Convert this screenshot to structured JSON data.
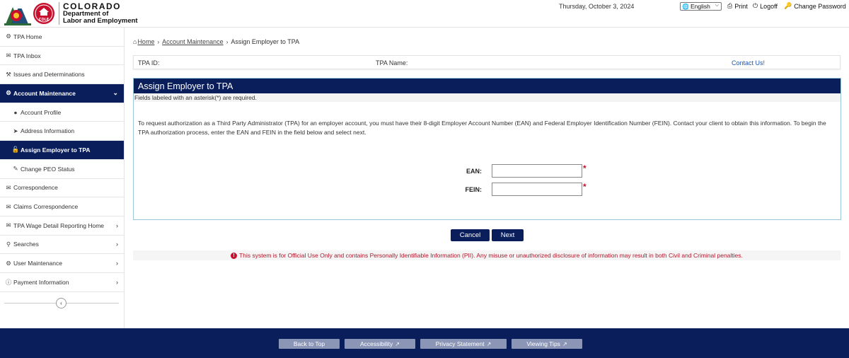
{
  "header": {
    "logo": {
      "state": "COLORADO",
      "line2": "Department of",
      "line3": "Labor and Employment",
      "seal_text": "CDLE"
    },
    "date": "Thursday, October 3, 2024",
    "language": {
      "selected": "English",
      "icon": "globe-icon"
    },
    "links": [
      {
        "label": "Print",
        "icon": "print-icon"
      },
      {
        "label": "Logoff",
        "icon": "power-icon"
      },
      {
        "label": "Change Password",
        "icon": "key-icon"
      }
    ]
  },
  "sidebar": {
    "items": [
      {
        "label": "TPA Home",
        "icon": "gauge-icon"
      },
      {
        "label": "TPA Inbox",
        "icon": "envelope-icon"
      },
      {
        "label": "Issues and Determinations",
        "icon": "gavel-icon"
      },
      {
        "label": "Account Maintenance",
        "icon": "cogs-icon"
      },
      {
        "label": "Account Profile",
        "icon": "user-icon"
      },
      {
        "label": "Address Information",
        "icon": "location-arrow-icon"
      },
      {
        "label": "Assign Employer to TPA",
        "icon": "lock-icon"
      },
      {
        "label": "Change PEO Status",
        "icon": "edit-icon"
      },
      {
        "label": "Correspondence",
        "icon": "envelope-icon"
      },
      {
        "label": "Claims Correspondence",
        "icon": "envelope-icon"
      },
      {
        "label": "TPA Wage Detail Reporting Home",
        "icon": "envelope-icon"
      },
      {
        "label": "Searches",
        "icon": "search-icon"
      },
      {
        "label": "User Maintenance",
        "icon": "cogs-icon"
      },
      {
        "label": "Payment Information",
        "icon": "info-circle-icon"
      }
    ]
  },
  "breadcrumb": {
    "home": "Home",
    "parent": "Account Maintenance",
    "current": "Assign Employer to TPA"
  },
  "tpa_bar": {
    "tpa_id_label": "TPA ID:",
    "tpa_name_label": "TPA Name:",
    "contact": "Contact Us!"
  },
  "panel": {
    "title": "Assign Employer to TPA",
    "required_note": "Fields labeled with an asterisk(*) are required.",
    "instructions": "To request authorization as a Third Party Administrator (TPA) for an employer account, you must have their 8-digit Employer Account Number (EAN) and Federal Employer Identification Number (FEIN). Contact your client to obtain this information. To begin the TPA authorization process, enter the EAN and FEIN in the field below and select next.",
    "fields": [
      {
        "label": "EAN:",
        "value": "",
        "required": "*"
      },
      {
        "label": "FEIN:",
        "value": "",
        "required": "*"
      }
    ]
  },
  "actions": {
    "cancel": "Cancel",
    "next": "Next"
  },
  "notice": "This system is for Official Use Only and contains Personally Identifiable Information (PII). Any misuse or unauthorized disclosure of information may result in both Civil and Criminal penalties.",
  "footer": {
    "buttons": [
      {
        "label": "Back to Top",
        "external": false
      },
      {
        "label": "Accessibility",
        "external": true
      },
      {
        "label": "Privacy Statement",
        "external": true
      },
      {
        "label": "Viewing Tips",
        "external": true
      }
    ]
  },
  "colors": {
    "navy": "#0a1e5c",
    "footer_button": "#8b95b6",
    "alert_red": "#b3172b",
    "link_blue": "#1a56b8",
    "panel_border": "#9cc8dc"
  }
}
